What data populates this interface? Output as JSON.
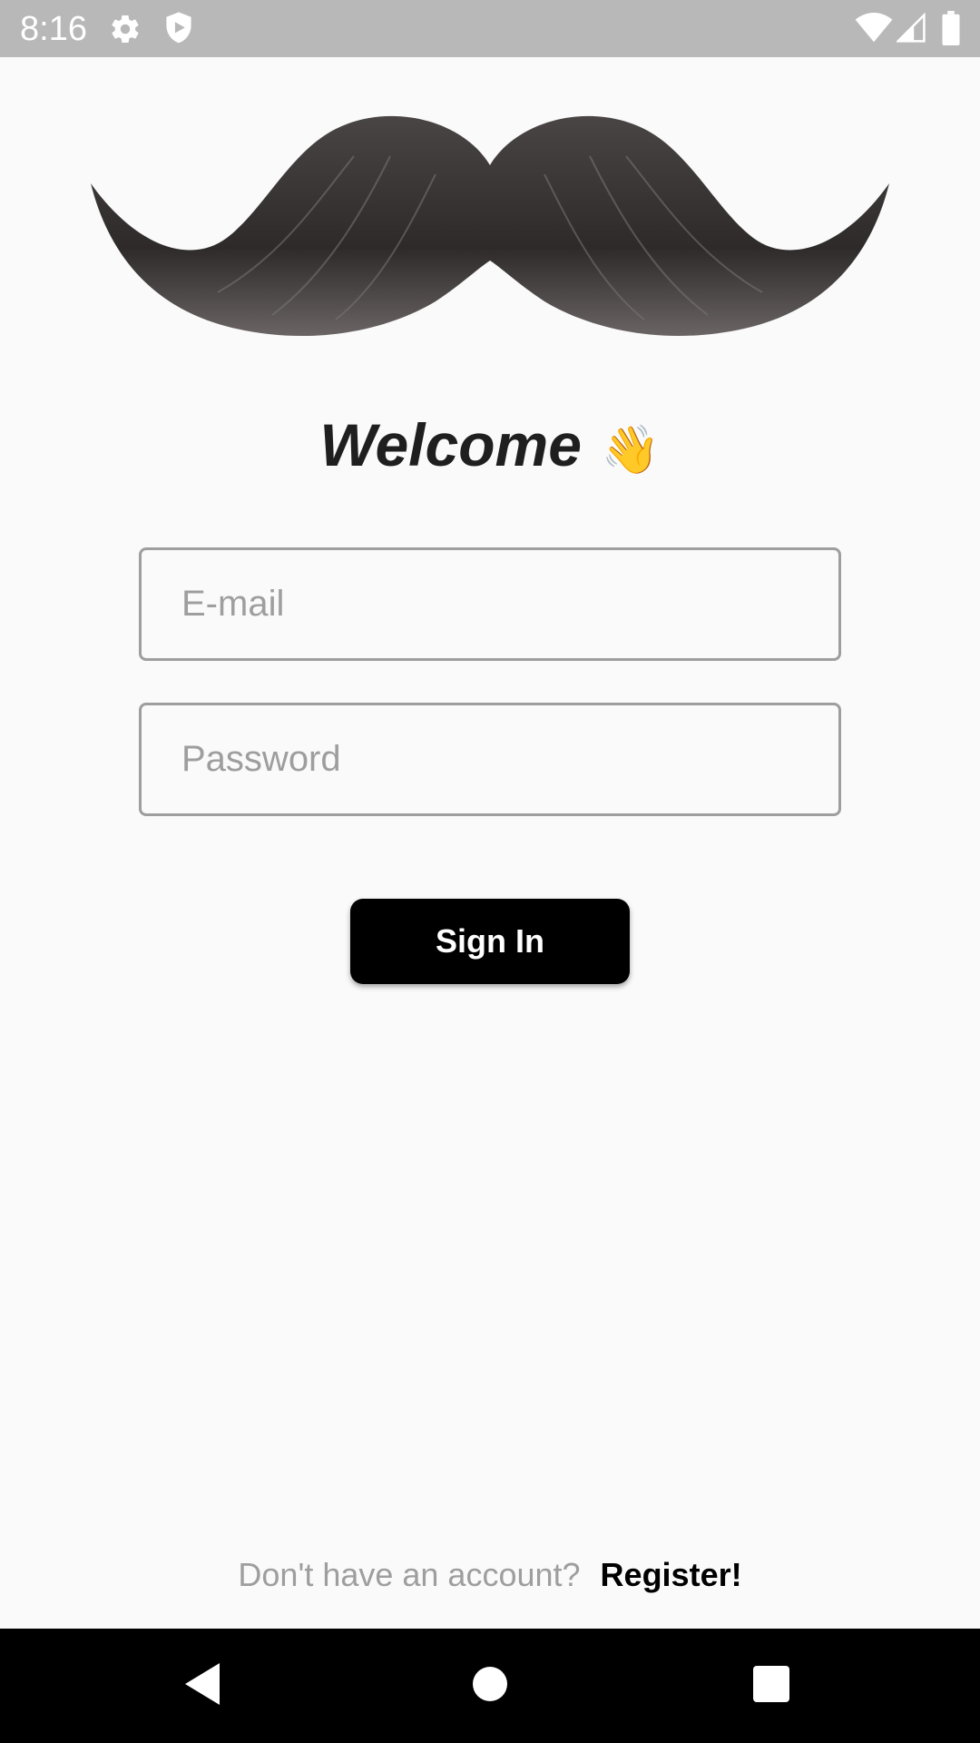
{
  "status_bar": {
    "time": "8:16",
    "icons": [
      "gear-icon",
      "shield-icon",
      "wifi-icon",
      "signal-icon",
      "battery-icon"
    ]
  },
  "logo": {
    "icon": "mustache-icon"
  },
  "welcome": {
    "title": "Welcome",
    "emoji": "👋"
  },
  "form": {
    "email_placeholder": "E-mail",
    "email_value": "",
    "password_placeholder": "Password",
    "password_value": "",
    "sign_in_label": "Sign In"
  },
  "footer": {
    "prompt": "Don't have an account?",
    "register_label": "Register!"
  },
  "nav_bar": {
    "buttons": [
      "back-icon",
      "home-icon",
      "recents-icon"
    ]
  },
  "colors": {
    "background": "#fafafa",
    "status_bar": "#b8b8b8",
    "primary_button": "#000000",
    "placeholder": "#9e9e9e",
    "nav_bar": "#000000"
  }
}
